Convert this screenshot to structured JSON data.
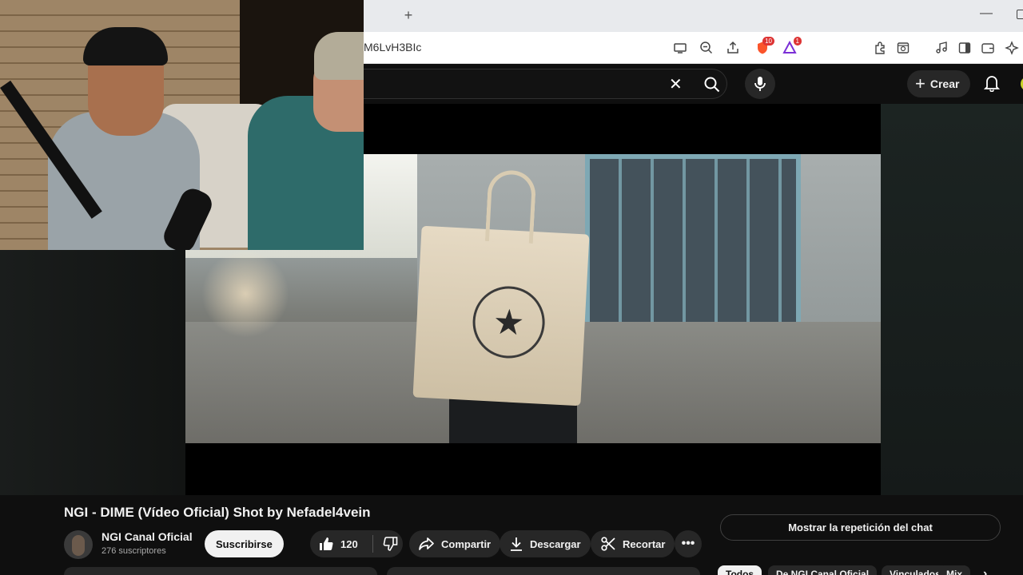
{
  "browser": {
    "new_tab_label": "+",
    "url": "M6LvH3BIc",
    "icons": [
      "cast-icon",
      "zoom-out-icon",
      "share-icon",
      "brave-shield-icon",
      "rewards-icon",
      "extensions-icon",
      "reading-list-icon",
      "media-icon",
      "sidebar-icon",
      "wallet-icon",
      "leo-ai-icon"
    ],
    "badges": {
      "shield": "10",
      "rewards": "1"
    },
    "window_min": "—"
  },
  "yt_header": {
    "search_clear": "✕",
    "crear_label": "Crear",
    "crear_plus": "+"
  },
  "video": {
    "title": "NGI - DIME (Vídeo Oficial) Shot by Nefadel4vein",
    "stamp_glyph": "★"
  },
  "channel": {
    "name": "NGI Canal Oficial",
    "subscribers": "276 suscriptores",
    "subscribe_label": "Suscribirse"
  },
  "actions": {
    "likes": "120",
    "share_label": "Compartir",
    "download_label": "Descargar",
    "clip_label": "Recortar",
    "more_label": "•••"
  },
  "sidebar": {
    "chat_replay_label": "Mostrar la repetición del chat",
    "chips": [
      "Todos",
      "De NGI Canal Oficial",
      "Vinculados",
      "Mix"
    ],
    "chips_next": "›"
  },
  "colors": {
    "background": "#0f0f0f",
    "pill": "#272727",
    "text": "#f1f1f1",
    "secondary_text": "#aaaaaa",
    "badge_red": "#dd3333"
  }
}
